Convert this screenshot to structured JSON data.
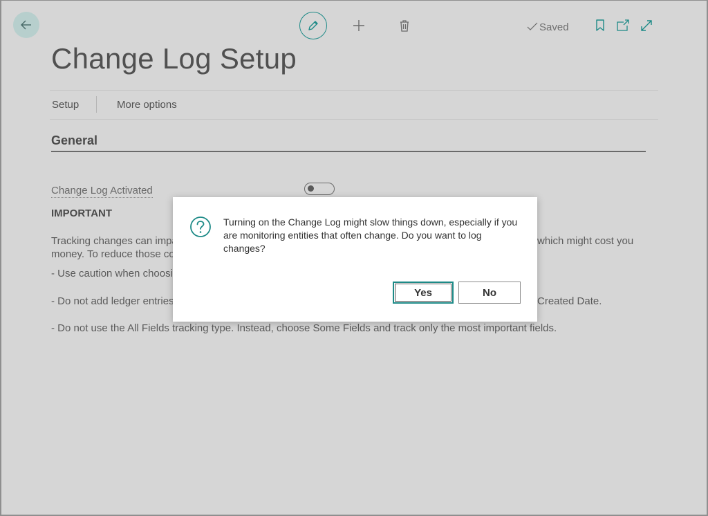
{
  "header": {
    "back_icon": "arrow-left-icon",
    "edit_icon": "pencil-icon",
    "new_icon": "plus-icon",
    "delete_icon": "trash-icon",
    "status_text": "Saved",
    "status_icon": "checkmark-icon",
    "bookmark_icon": "bookmark-icon",
    "open_new_window_icon": "open-new-window-icon",
    "expand_icon": "expand-icon"
  },
  "page": {
    "title": "Change Log Setup",
    "actions": [
      "Setup",
      "More options"
    ]
  },
  "section": {
    "title": "General",
    "field_label": "Change Log Activated",
    "field_value": false,
    "important_title": "IMPORTANT",
    "lines": [
      "Tracking changes can impa",
      "which might cost you",
      "money. To reduce those co",
      "- Use caution when choosir",
      "- Do not add ledger entries",
      "Created Date.",
      "- Do not use the All Fields tracking type. Instead, choose Some Fields and track only the most important fields."
    ]
  },
  "dialog": {
    "icon": "question-circle-icon",
    "message": "Turning on the Change Log might slow things down, especially if you are monitoring entities that often change. Do you want to log changes?",
    "yes_label": "Yes",
    "no_label": "No"
  },
  "colors": {
    "accent": "#1d8a87",
    "page_background": "#d6d6d6",
    "dialog_background": "#ffffff"
  }
}
